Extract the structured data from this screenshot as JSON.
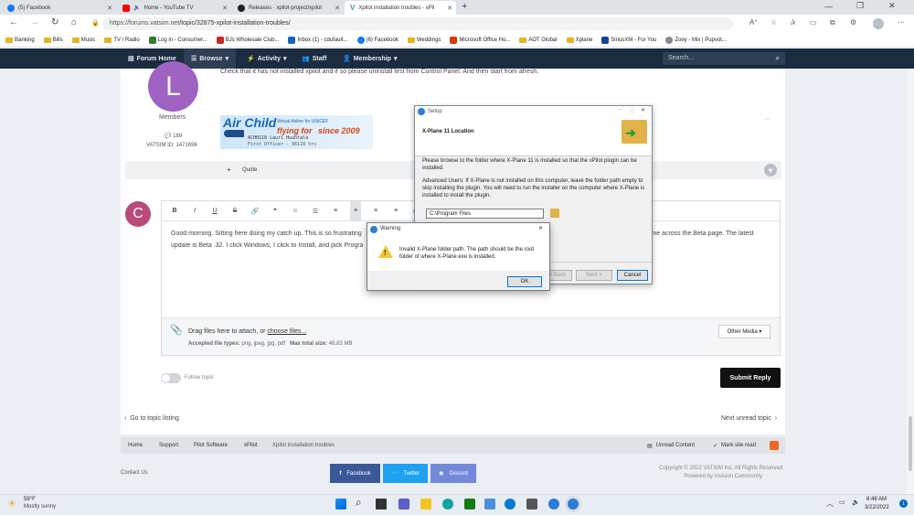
{
  "browser": {
    "tabs": [
      {
        "label": "(5) Facebook",
        "color": "#1877f2"
      },
      {
        "label": "Home - YouTube TV",
        "color": "#ff0000"
      },
      {
        "label": "Releases · xpilot-project/xpilot",
        "color": "#222222"
      },
      {
        "label": "Xpilot installation troubles - xPil",
        "color": "#2a9d8f"
      }
    ],
    "url_host": "https://forums.vatsim.net",
    "url_path": "/topic/32875-xpilot-installation-troubles/",
    "bookmarks": [
      "Banking",
      "Bills",
      "Music",
      "TV / Radio",
      "Log in - Consumer...",
      "BJs Wholesale Club...",
      "Inbox (1) - cdufault...",
      "(6) Facebook",
      "Weddings",
      "Microsoft Office Ho...",
      "AOT Global",
      "Xplane",
      "SiriusXM - For You",
      "Zoey - Mix | Pupvot..."
    ]
  },
  "nav": {
    "items": [
      "Forum Home",
      "Browse",
      "Activity",
      "Staff",
      "Membership"
    ],
    "search_placeholder": "Search..."
  },
  "post": {
    "text": "Check that it has not installed xpilot and if so please uninstall first from Control Panel. And then start from afresh.",
    "avatar_letter": "L",
    "member_role": "Members",
    "post_count": "189",
    "vatsim_id": "VATSIM ID: 1471696",
    "banner_title": "Air Child",
    "banner_sub1": "Virtual Airline for UNICEF",
    "banner_flying": "flying for",
    "banner_since": "since 2009",
    "banner_callsign": "ACH0118 Lauri Huuhtala",
    "banner_officer": "First Officer - 96110 hrs",
    "quote_label": "Quote"
  },
  "editor": {
    "avatar_letter": "C",
    "text_line1": "Good morning. Sitting here doing my catch up.  This is so frustrating",
    "text_line1b": "came across the Beta page. The latest",
    "text_line2": "update is Beta .32. I click Windows, I click to Install, and pick Program",
    "drag_text": "Drag files here to attach, or",
    "choose_files": "choose files...",
    "accepted": "Accepted file types:",
    "accepted_types": "png, jpeg, jpg, pdf",
    "max_size_label": "Max total size:",
    "max_size": "48.83 MB",
    "other_media": "Other Media",
    "follow_topic": "Follow topic",
    "submit": "Submit Reply"
  },
  "topic_nav": {
    "prev": "Go to topic listing",
    "next": "Next unread topic"
  },
  "breadcrumb": [
    "Home",
    "Support",
    "Pilot Software",
    "xPilot",
    "Xpilot installation troubles"
  ],
  "footer": {
    "unread": "Unread Content",
    "mark_read": "Mark site read",
    "contact": "Contact Us",
    "facebook": "Facebook",
    "twitter": "Twitter",
    "discord": "Discord",
    "copyright": "Copyright © 2022 VATSIM Inc. All Rights Reserved.",
    "powered": "Powered by Invision Community"
  },
  "setup": {
    "title": "Setup",
    "header": "X-Plane 11 Location",
    "para1": "Please browse to the folder where X-Plane 11 is installed so that the xPilot plugin can be installed.",
    "para2": "Advanced Users: If X-Plane is not installed on this computer, leave the folder path empty to skip installing the plugin. You will need to run the installer on the computer where X-Plane is installed to install the plugin.",
    "path": "C:\\Program Files",
    "back": "< Back",
    "next": "Next >",
    "cancel": "Cancel"
  },
  "warning": {
    "title": "Warning",
    "message": "Invalid X-Plane folder path. The path should be the root folder of where X-Plane.exe is installed.",
    "ok": "OK"
  },
  "taskbar": {
    "temp": "59°F",
    "weather": "Mostly sunny",
    "time": "8:48 AM",
    "date": "3/22/2022",
    "badge": "1"
  },
  "colors": {
    "nav_bg": "#1c2c40",
    "avatar_l": "#a063c4",
    "avatar_c": "#b94a7a",
    "facebook": "#3b5998",
    "twitter": "#1da1f2",
    "discord": "#7289da"
  }
}
